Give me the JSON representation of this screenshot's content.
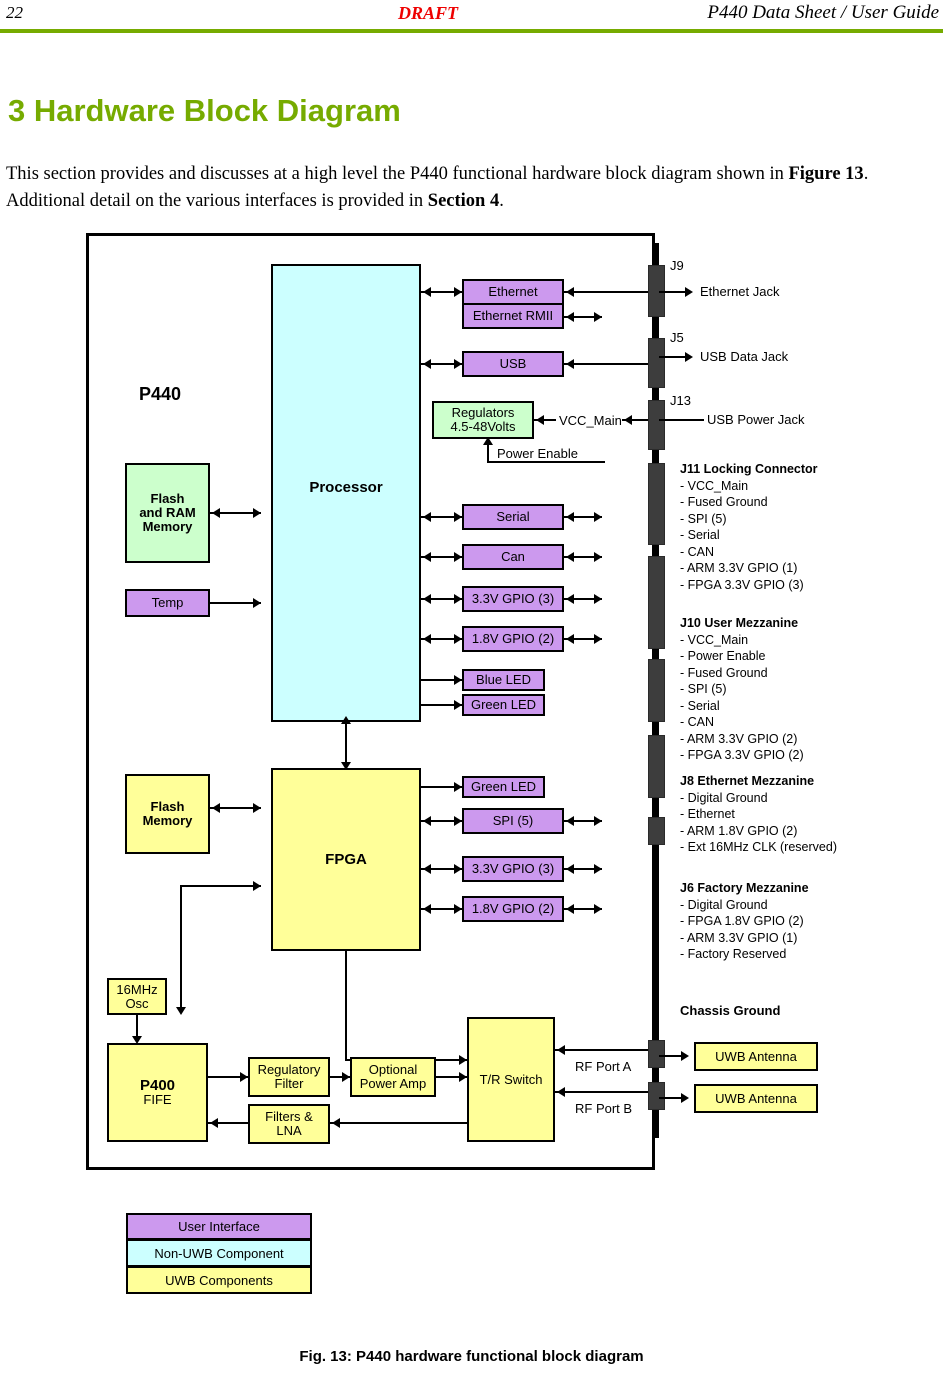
{
  "header": {
    "page_number": "22",
    "draft_marker": "DRAFT",
    "doc_title": "P440 Data Sheet / User Guide",
    "rule_color": "#76ab00"
  },
  "section": {
    "heading": "3  Hardware Block Diagram",
    "heading_color": "#76ab00",
    "paragraph_part1": "This section provides and discusses at a high level the P440 functional hardware block diagram shown in ",
    "paragraph_ref1": "Figure 13",
    "paragraph_part2": ".  Additional detail on the various interfaces is provided in ",
    "paragraph_ref2": "Section 4",
    "paragraph_part3": "."
  },
  "diagram": {
    "device_label": "P440",
    "core_blocks": {
      "processor": "Processor",
      "fpga": "FPGA",
      "flash_and_ram": "Flash\nand RAM\nMemory",
      "flash_and_ram_l1": "Flash",
      "flash_and_ram_l2": "and RAM",
      "flash_and_ram_l3": "Memory",
      "temp": "Temp",
      "flash_memory_l1": "Flash",
      "flash_memory_l2": "Memory",
      "osc_l1": "16MHz",
      "osc_l2": "Osc",
      "fife_l1": "P400",
      "fife_l2": "FIFE"
    },
    "processor_peripherals": [
      {
        "label": "Ethernet",
        "kind": "ui"
      },
      {
        "label": "Ethernet RMII",
        "kind": "ui"
      },
      {
        "label": "USB",
        "kind": "ui"
      },
      {
        "label": "Serial",
        "kind": "ui"
      },
      {
        "label": "Can",
        "kind": "ui"
      },
      {
        "label": "3.3V GPIO (3)",
        "kind": "ui"
      },
      {
        "label": "1.8V GPIO (2)",
        "kind": "ui"
      },
      {
        "label": "Blue LED",
        "kind": "ui"
      },
      {
        "label": "Green LED",
        "kind": "ui"
      }
    ],
    "fpga_peripherals": [
      {
        "label": "Green LED",
        "kind": "ui"
      },
      {
        "label": "SPI (5)",
        "kind": "ui"
      },
      {
        "label": "3.3V GPIO (3)",
        "kind": "ui"
      },
      {
        "label": "1.8V GPIO (2)",
        "kind": "ui"
      }
    ],
    "regulators": {
      "line1": "Regulators",
      "line2": "4.5-48Volts",
      "vcc_label": "VCC_Main",
      "power_enable_label": "Power Enable"
    },
    "rf_chain": [
      {
        "label_l1": "Regulatory",
        "label_l2": "Filter"
      },
      {
        "label_l1": "Optional",
        "label_l2": "Power Amp"
      },
      {
        "label_l1": "T/R Switch",
        "label_l2": ""
      },
      {
        "label_l1": "Filters &",
        "label_l2": "LNA"
      }
    ],
    "rf_ports": [
      {
        "label": "RF Port A"
      },
      {
        "label": "RF Port B"
      }
    ],
    "antennas": [
      {
        "label": "UWB Antenna"
      },
      {
        "label": "UWB Antenna"
      }
    ],
    "jack_labels": [
      {
        "id": "J9",
        "name": "Ethernet Jack"
      },
      {
        "id": "J5",
        "name": "USB Data Jack"
      },
      {
        "id": "J13",
        "name": "USB Power Jack"
      }
    ],
    "connectors": [
      {
        "title": "J11 Locking Connector",
        "pins": [
          "- VCC_Main",
          "- Fused Ground",
          "- SPI (5)",
          "- Serial",
          "- CAN",
          "- ARM 3.3V GPIO (1)",
          "- FPGA 3.3V GPIO (3)"
        ]
      },
      {
        "title": "J10 User Mezzanine",
        "pins": [
          "- VCC_Main",
          "- Power Enable",
          "- Fused Ground",
          "- SPI (5)",
          "- Serial",
          "- CAN",
          "- ARM 3.3V GPIO (2)",
          "- FPGA 3.3V GPIO (2)"
        ]
      },
      {
        "title": "J8 Ethernet Mezzanine",
        "pins": [
          "- Digital Ground",
          "- Ethernet",
          "- ARM 1.8V GPIO (2)",
          "- Ext 16MHz CLK (reserved)"
        ]
      },
      {
        "title": "J6 Factory Mezzanine",
        "pins": [
          "- Digital Ground",
          "- FPGA 1.8V GPIO (2)",
          "- ARM 3.3V GPIO (1)",
          "- Factory Reserved"
        ]
      }
    ],
    "chassis_ground": "Chassis Ground"
  },
  "legend": {
    "rows": [
      {
        "label": "User Interface",
        "color": "#cc99ee"
      },
      {
        "label": "Non-UWB Component",
        "color": "#ccffff"
      },
      {
        "label": "UWB Components",
        "color": "#ffff99"
      }
    ]
  },
  "caption": "Fig. 13: P440 hardware functional block diagram"
}
